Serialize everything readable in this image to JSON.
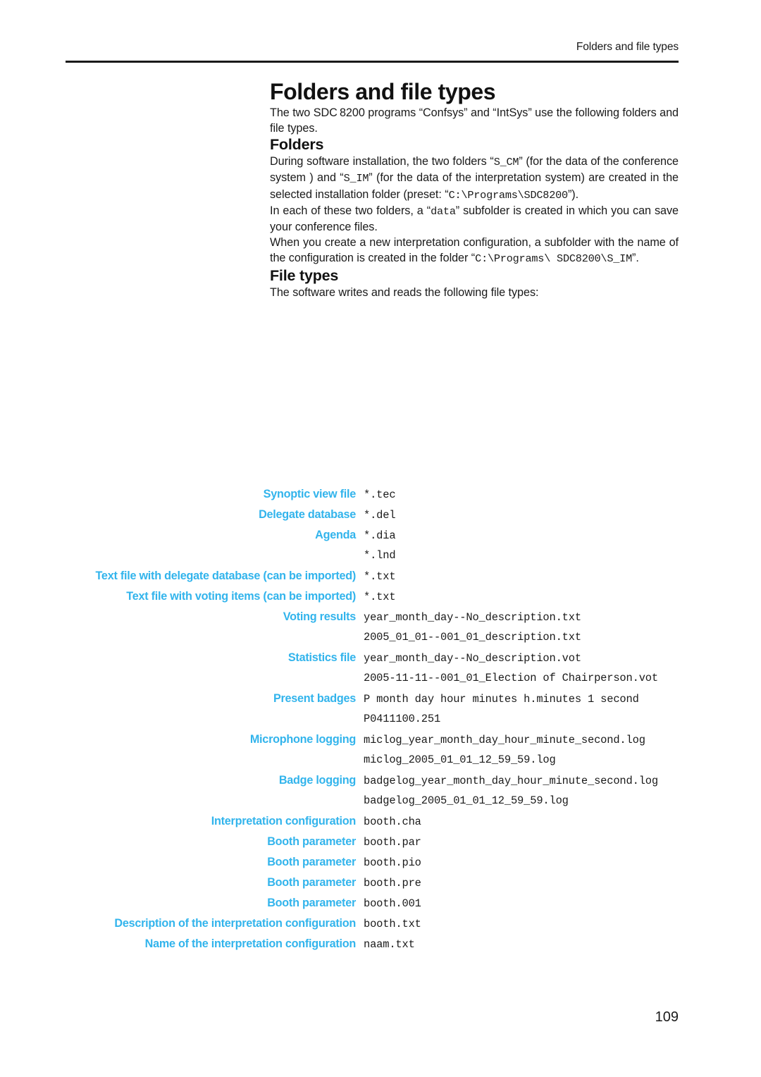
{
  "header": {
    "running_head": "Folders and file types"
  },
  "title": "Folders and file types",
  "intro": {
    "part1": "The two SDC 8200 programs “Confsys” and “IntSys” use the following folders and file types."
  },
  "sections": [
    {
      "heading": "Folders",
      "paragraphs": [
        {
          "segments": [
            {
              "text": "During software installation, the two folders “",
              "mono": false
            },
            {
              "text": "S_CM",
              "mono": true
            },
            {
              "text": "” (for the data of the conference system ) and “",
              "mono": false
            },
            {
              "text": "S_IM",
              "mono": true
            },
            {
              "text": "” (for the data of the interpretation system) are created in the selected installation folder (preset: “",
              "mono": false
            },
            {
              "text": "C:\\Programs\\SDC8200",
              "mono": true
            },
            {
              "text": "”).",
              "mono": false
            }
          ]
        },
        {
          "segments": [
            {
              "text": "In each of these two folders, a “",
              "mono": false
            },
            {
              "text": "data",
              "mono": true
            },
            {
              "text": "” subfolder is created in which you can save your conference files.",
              "mono": false
            }
          ]
        },
        {
          "segments": [
            {
              "text": "When you create a new interpretation configuration, a subfolder with the name of the configuration is created in the folder “",
              "mono": false
            },
            {
              "text": "C:\\Programs\\ SDC8200\\S_IM",
              "mono": true
            },
            {
              "text": "”.",
              "mono": false
            }
          ]
        }
      ]
    },
    {
      "heading": "File types",
      "paragraphs": [
        {
          "segments": [
            {
              "text": "The software writes and reads the following file types:",
              "mono": false
            }
          ]
        }
      ]
    }
  ],
  "file_types": [
    {
      "label": "Synoptic view file",
      "value": "*.tec"
    },
    {
      "label": "Delegate database",
      "value": "*.del"
    },
    {
      "label": "Agenda",
      "value": "*.dia"
    },
    {
      "label": "",
      "value": "*.lnd"
    },
    {
      "label": "Text file with delegate database (can be imported)",
      "value": "*.txt"
    },
    {
      "label": "Text file with voting items (can be imported)",
      "value": "*.txt"
    },
    {
      "label": "Voting results",
      "value": "year_month_day--No_description.txt"
    },
    {
      "label": "",
      "value": "2005_01_01--001_01_description.txt"
    },
    {
      "label": "Statistics file",
      "value": "year_month_day--No_description.vot"
    },
    {
      "label": "",
      "value": "2005-11-11--001_01_Election of Chairperson.vot"
    },
    {
      "label": "Present badges",
      "value": "P month day hour minutes h.minutes 1 second"
    },
    {
      "label": "",
      "value": "P0411100.251"
    },
    {
      "label": "Microphone logging",
      "value": "miclog_year_month_day_hour_minute_second.log"
    },
    {
      "label": "",
      "value": "miclog_2005_01_01_12_59_59.log"
    },
    {
      "label": "Badge logging",
      "value": "badgelog_year_month_day_hour_minute_second.log"
    },
    {
      "label": "",
      "value": "badgelog_2005_01_01_12_59_59.log"
    },
    {
      "label": "Interpretation configuration",
      "value": "booth.cha"
    },
    {
      "label": "Booth parameter",
      "value": "booth.par"
    },
    {
      "label": "Booth parameter",
      "value": "booth.pio"
    },
    {
      "label": "Booth parameter",
      "value": "booth.pre"
    },
    {
      "label": "Booth parameter",
      "value": "booth.001"
    },
    {
      "label": "Description of the interpretation configuration",
      "value": "booth.txt"
    },
    {
      "label": "Name of the interpretation configuration",
      "value": "naam.txt"
    }
  ],
  "page_number": "109",
  "colors": {
    "label_blue": "#32b4ec",
    "text_black": "#1a1a1a"
  }
}
